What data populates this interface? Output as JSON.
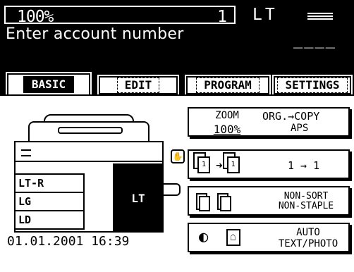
{
  "status": {
    "zoom_percent": "100%",
    "copy_count": "1",
    "paper_size": "LT",
    "message": "Enter account number",
    "account_entry": "____"
  },
  "tabs": [
    {
      "label": "BASIC",
      "active": true
    },
    {
      "label": "EDIT",
      "active": false
    },
    {
      "label": "PROGRAM",
      "active": false
    },
    {
      "label": "SETTINGS",
      "active": false
    }
  ],
  "copier": {
    "trays": [
      "LT-R",
      "LG",
      "LD"
    ],
    "selected_tray_label": "LT"
  },
  "datetime": "01.01.2001 16:39",
  "buttons": {
    "zoom": {
      "label": "ZOOM",
      "value": "100%",
      "org_copy": "ORG.→COPY",
      "mode": "APS"
    },
    "duplex": {
      "mode": "1 → 1",
      "front_sheet": "1",
      "back_sheet": "1"
    },
    "finishing": {
      "line1": "NON-SORT",
      "line2": "NON-STAPLE"
    },
    "image_mode": {
      "line1": "AUTO",
      "line2": "TEXT/PHOTO"
    }
  }
}
